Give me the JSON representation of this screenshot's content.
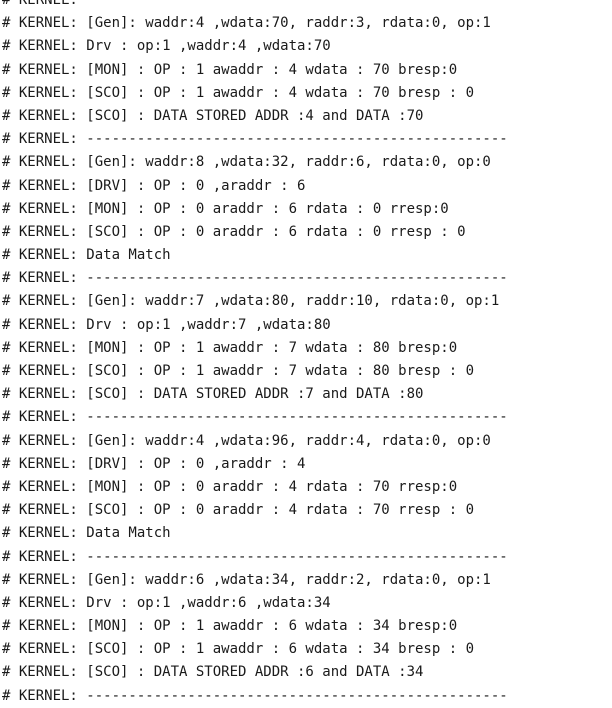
{
  "log": {
    "lines": [
      "# KERNEL:",
      "# KERNEL: [Gen]: waddr:4 ,wdata:70, raddr:3, rdata:0, op:1",
      "# KERNEL: Drv : op:1 ,waddr:4 ,wdata:70",
      "# KERNEL: [MON] : OP : 1 awaddr : 4 wdata : 70 bresp:0",
      "# KERNEL: [SCO] : OP : 1 awaddr : 4 wdata : 70 bresp : 0",
      "# KERNEL: [SCO] : DATA STORED ADDR :4 and DATA :70",
      "# KERNEL: --------------------------------------------------",
      "# KERNEL: [Gen]: waddr:8 ,wdata:32, raddr:6, rdata:0, op:0",
      "# KERNEL: [DRV] : OP : 0 ,araddr : 6",
      "# KERNEL: [MON] : OP : 0 araddr : 6 rdata : 0 rresp:0",
      "# KERNEL: [SCO] : OP : 0 araddr : 6 rdata : 0 rresp : 0",
      "# KERNEL: Data Match",
      "# KERNEL: --------------------------------------------------",
      "# KERNEL: [Gen]: waddr:7 ,wdata:80, raddr:10, rdata:0, op:1",
      "# KERNEL: Drv : op:1 ,waddr:7 ,wdata:80",
      "# KERNEL: [MON] : OP : 1 awaddr : 7 wdata : 80 bresp:0",
      "# KERNEL: [SCO] : OP : 1 awaddr : 7 wdata : 80 bresp : 0",
      "# KERNEL: [SCO] : DATA STORED ADDR :7 and DATA :80",
      "# KERNEL: --------------------------------------------------",
      "# KERNEL: [Gen]: waddr:4 ,wdata:96, raddr:4, rdata:0, op:0",
      "# KERNEL: [DRV] : OP : 0 ,araddr : 4",
      "# KERNEL: [MON] : OP : 0 araddr : 4 rdata : 70 rresp:0",
      "# KERNEL: [SCO] : OP : 0 araddr : 4 rdata : 70 rresp : 0",
      "# KERNEL: Data Match",
      "# KERNEL: --------------------------------------------------",
      "# KERNEL: [Gen]: waddr:6 ,wdata:34, raddr:2, rdata:0, op:1",
      "# KERNEL: Drv : op:1 ,waddr:6 ,wdata:34",
      "# KERNEL: [MON] : OP : 1 awaddr : 6 wdata : 34 bresp:0",
      "# KERNEL: [SCO] : OP : 1 awaddr : 6 wdata : 34 bresp : 0",
      "# KERNEL: [SCO] : DATA STORED ADDR :6 and DATA :34",
      "# KERNEL: --------------------------------------------------"
    ]
  }
}
